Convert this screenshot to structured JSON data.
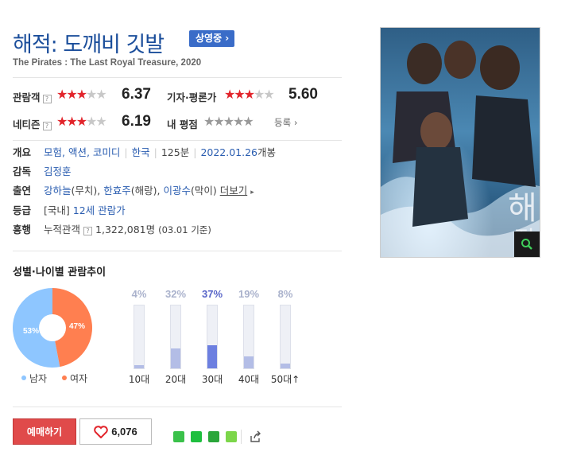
{
  "movie": {
    "title": "해적: 도깨비 깃발",
    "status_badge": "상영중",
    "subtitle": "The Pirates : The Last Royal Treasure, 2020"
  },
  "ratings": {
    "audience": {
      "label": "관람객",
      "score": "6.37",
      "stars_on": 3,
      "stars_total": 5
    },
    "critic": {
      "label": "기자·평론가",
      "score": "5.60",
      "stars_on": 3,
      "stars_total": 5
    },
    "netizen": {
      "label": "네티즌",
      "score": "6.19",
      "stars_on": 3,
      "stars_total": 5
    },
    "my": {
      "label": "내 평점",
      "register_label": "등록"
    }
  },
  "info": {
    "overview_key": "개요",
    "genres": "모험, 액션, 코미디",
    "country": "한국",
    "runtime": "125분",
    "release_date": "2022.01.26",
    "release_suffix": "개봉",
    "director_key": "감독",
    "director": "김정훈",
    "cast_key": "출연",
    "cast_1": "강하늘",
    "cast_1_role": "(무치), ",
    "cast_2": "한효주",
    "cast_2_role": "(해랑), ",
    "cast_3": "이광수",
    "cast_3_role": "(막이) ",
    "more_label": "더보기",
    "rating_key": "등급",
    "rating_region": "[국내]",
    "rating_value": "12세 관람가",
    "box_key": "흥행",
    "box_label": "누적관객",
    "box_value": "1,322,081명",
    "box_date": "(03.01 기준)"
  },
  "demographics": {
    "section_title": "성별·나이별 관람추이",
    "gender": {
      "male_pct": 53,
      "female_pct": 47,
      "male_label": "남자",
      "female_label": "여자",
      "male_text": "53%",
      "female_text": "47%",
      "male_color": "#8ec6ff",
      "female_color": "#ff7f50"
    }
  },
  "chart_data": {
    "type": "bar",
    "categories": [
      "10대",
      "20대",
      "30대",
      "40대",
      "50대↑"
    ],
    "values": [
      4,
      32,
      37,
      19,
      8
    ],
    "value_labels": [
      "4%",
      "32%",
      "37%",
      "19%",
      "8%"
    ],
    "ylim": [
      0,
      100
    ],
    "highlight_index": 2
  },
  "actions": {
    "book_label": "예매하기",
    "like_count": "6,076"
  },
  "colors": {
    "title": "#1b4e9b",
    "badge": "#3a6cc8",
    "star_on": "#e2242b",
    "book_button": "#e04a4a"
  }
}
